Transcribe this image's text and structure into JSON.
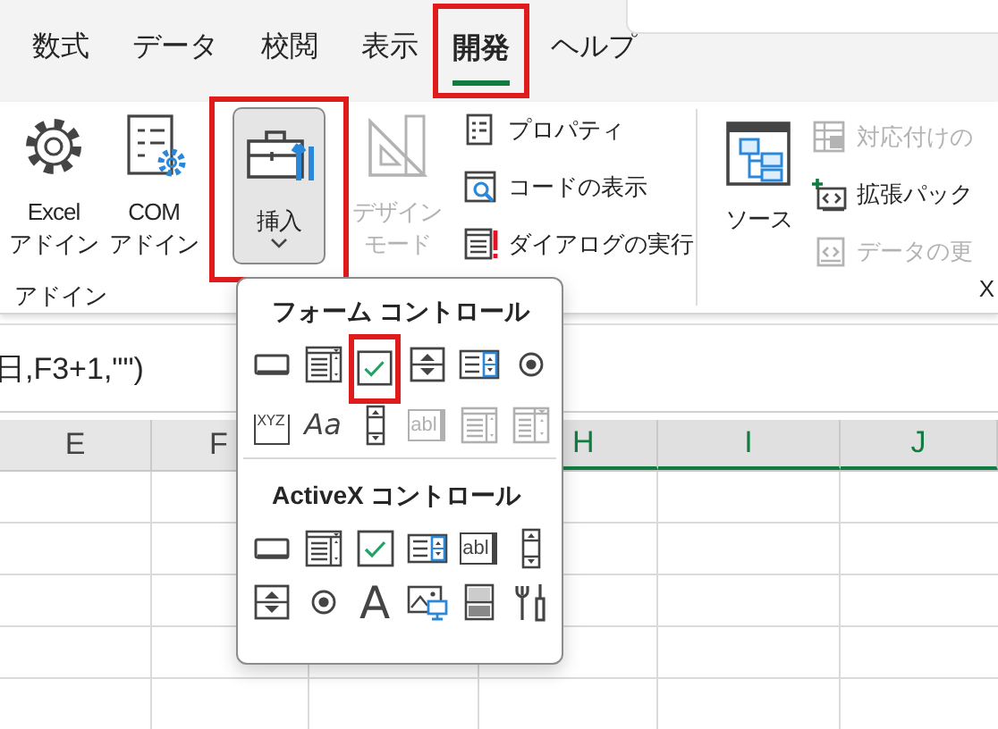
{
  "tabs": [
    {
      "label": "数式",
      "selected": false,
      "highlighted": false
    },
    {
      "label": "データ",
      "selected": false,
      "highlighted": false
    },
    {
      "label": "校閲",
      "selected": false,
      "highlighted": false
    },
    {
      "label": "表示",
      "selected": false,
      "highlighted": false
    },
    {
      "label": "開発",
      "selected": true,
      "highlighted": true
    },
    {
      "label": "ヘルプ",
      "selected": false,
      "highlighted": false
    }
  ],
  "ribbon": {
    "groups": [
      {
        "label": "アドイン",
        "items": [
          {
            "kind": "gear",
            "lines": [
              "Excel",
              "アドイン"
            ],
            "disabled": false,
            "pressed": false,
            "highlighted": false,
            "dropdown": false
          },
          {
            "kind": "com",
            "lines": [
              "COM",
              "アドイン"
            ],
            "disabled": false,
            "pressed": false,
            "highlighted": false,
            "dropdown": false
          }
        ]
      },
      {
        "items": [
          {
            "kind": "toolbox",
            "lines": [
              "挿入"
            ],
            "disabled": false,
            "pressed": true,
            "highlighted": true,
            "dropdown": true
          },
          {
            "kind": "ruler",
            "lines": [
              "デザイン",
              "モード"
            ],
            "disabled": true,
            "pressed": false,
            "highlighted": false,
            "dropdown": false
          },
          {
            "kind": "stack",
            "items": [
              {
                "kind": "properties",
                "label": "プロパティ",
                "disabled": false
              },
              {
                "kind": "code",
                "label": "コードの表示",
                "disabled": false
              },
              {
                "kind": "dialog",
                "label": "ダイアログの実行",
                "disabled": false
              }
            ]
          }
        ]
      },
      {
        "label": "X",
        "items": [
          {
            "kind": "source",
            "lines": [
              "ソース"
            ],
            "disabled": false,
            "pressed": false,
            "highlighted": false,
            "dropdown": false
          },
          {
            "kind": "stack",
            "items": [
              {
                "kind": "mapping",
                "label": "対応付けの",
                "disabled": true
              },
              {
                "kind": "pack",
                "label": "拡張パック",
                "disabled": false
              },
              {
                "kind": "refresh",
                "label": "データの更",
                "disabled": true
              }
            ]
          }
        ]
      }
    ]
  },
  "formula_bar": {
    "value": "日,F3+1,\"\")"
  },
  "columns": [
    {
      "label": "E",
      "selected": false
    },
    {
      "label": "F",
      "selected": false
    },
    {
      "label": "H",
      "selected": true
    },
    {
      "label": "I",
      "selected": true
    },
    {
      "label": "J",
      "selected": true
    }
  ],
  "insert_menu": {
    "sections": [
      {
        "title": "フォーム コントロール",
        "items": [
          {
            "kind": "button",
            "disabled": false,
            "highlighted": false
          },
          {
            "kind": "combo",
            "disabled": false,
            "highlighted": false
          },
          {
            "kind": "checkbox",
            "disabled": false,
            "highlighted": true
          },
          {
            "kind": "spin",
            "disabled": false,
            "highlighted": false
          },
          {
            "kind": "listbox",
            "disabled": false,
            "highlighted": false
          },
          {
            "kind": "option",
            "disabled": false,
            "highlighted": false
          },
          {
            "kind": "groupbox",
            "text": "XYZ",
            "disabled": false,
            "highlighted": false
          },
          {
            "kind": "label",
            "text": "Aa",
            "disabled": false,
            "highlighted": false
          },
          {
            "kind": "scrollbar",
            "disabled": false,
            "highlighted": false
          },
          {
            "kind": "textbox",
            "text": "abl",
            "disabled": true,
            "highlighted": false
          },
          {
            "kind": "combolist",
            "disabled": true,
            "highlighted": false
          },
          {
            "kind": "combodrop",
            "disabled": true,
            "highlighted": false
          }
        ]
      },
      {
        "title": "ActiveX コントロール",
        "items": [
          {
            "kind": "button",
            "disabled": false,
            "highlighted": false
          },
          {
            "kind": "combo",
            "disabled": false,
            "highlighted": false
          },
          {
            "kind": "checkbox",
            "disabled": false,
            "highlighted": false
          },
          {
            "kind": "listbox",
            "disabled": false,
            "highlighted": false
          },
          {
            "kind": "textbox",
            "text": "abl",
            "disabled": false,
            "highlighted": false
          },
          {
            "kind": "scrollbar",
            "disabled": false,
            "highlighted": false
          },
          {
            "kind": "spin",
            "disabled": false,
            "highlighted": false
          },
          {
            "kind": "option",
            "disabled": false,
            "highlighted": false
          },
          {
            "kind": "caption",
            "text": "A",
            "disabled": false,
            "highlighted": false
          },
          {
            "kind": "image",
            "disabled": false,
            "highlighted": false
          },
          {
            "kind": "toggle",
            "disabled": false,
            "highlighted": false
          },
          {
            "kind": "tools",
            "disabled": false,
            "highlighted": false
          }
        ]
      }
    ]
  }
}
